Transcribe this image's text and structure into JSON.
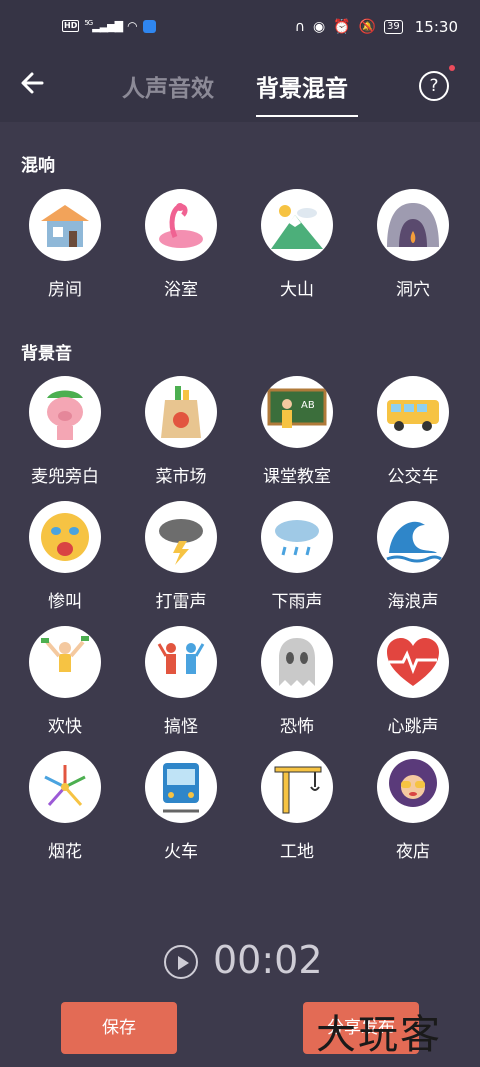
{
  "status": {
    "time": "15:30",
    "battery": "39",
    "hd": "HD",
    "network": "5G"
  },
  "header": {
    "tab_voice": "人声音效",
    "tab_bg": "背景混音"
  },
  "reverb": {
    "title": "混响",
    "items": [
      {
        "label": "房间",
        "icon": "house-icon"
      },
      {
        "label": "浴室",
        "icon": "flamingo-icon"
      },
      {
        "label": "大山",
        "icon": "mountain-icon"
      },
      {
        "label": "洞穴",
        "icon": "cave-icon"
      }
    ]
  },
  "background": {
    "title": "背景音",
    "items": [
      {
        "label": "麦兜旁白",
        "icon": "pig-icon"
      },
      {
        "label": "菜市场",
        "icon": "grocery-bag-icon"
      },
      {
        "label": "课堂教室",
        "icon": "classroom-icon"
      },
      {
        "label": "公交车",
        "icon": "bus-icon"
      },
      {
        "label": "惨叫",
        "icon": "scream-face-icon"
      },
      {
        "label": "打雷声",
        "icon": "thunder-cloud-icon"
      },
      {
        "label": "下雨声",
        "icon": "rain-cloud-icon"
      },
      {
        "label": "海浪声",
        "icon": "wave-icon"
      },
      {
        "label": "欢快",
        "icon": "happy-person-icon"
      },
      {
        "label": "搞怪",
        "icon": "dancing-people-icon"
      },
      {
        "label": "恐怖",
        "icon": "ghost-icon"
      },
      {
        "label": "心跳声",
        "icon": "heartbeat-icon"
      },
      {
        "label": "烟花",
        "icon": "fireworks-icon"
      },
      {
        "label": "火车",
        "icon": "train-icon"
      },
      {
        "label": "工地",
        "icon": "crane-icon"
      },
      {
        "label": "夜店",
        "icon": "disco-woman-icon"
      }
    ]
  },
  "player": {
    "time": "00:02"
  },
  "buttons": {
    "save": "保存",
    "share": "分享发布"
  },
  "watermark": "大玩客"
}
